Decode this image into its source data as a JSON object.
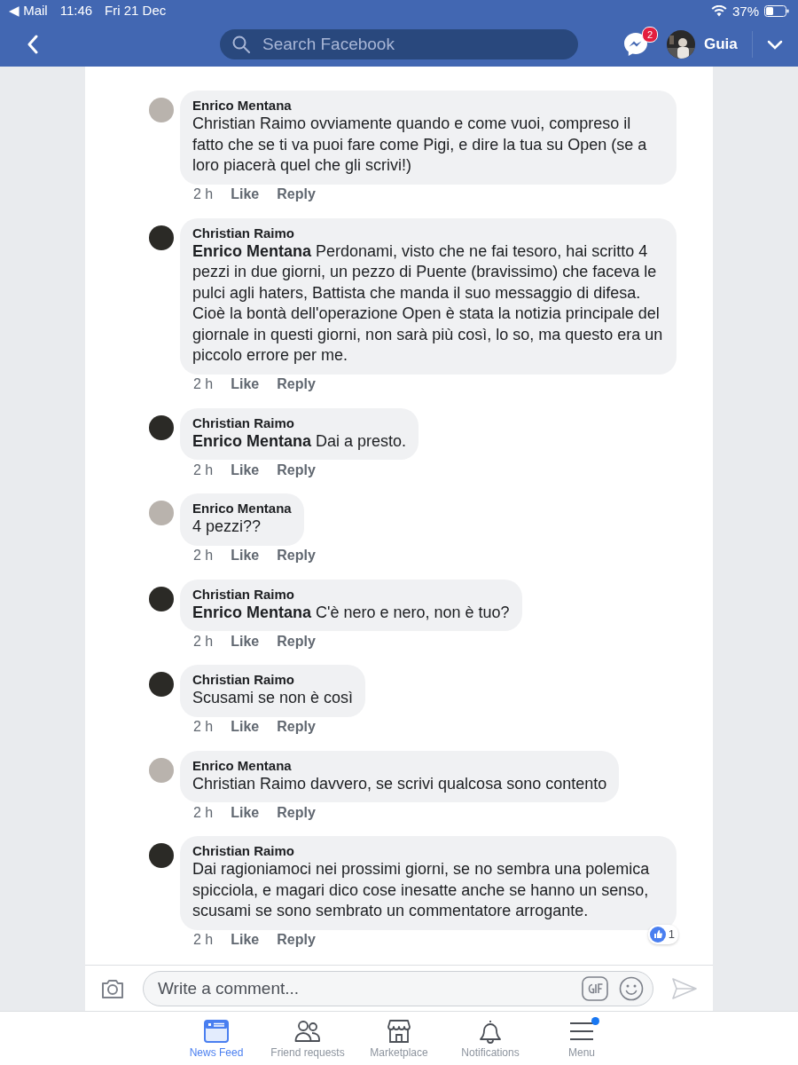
{
  "status_bar": {
    "back_app": "◀ Mail",
    "time": "11:46",
    "date": "Fri 21 Dec",
    "battery": "37%"
  },
  "header": {
    "search": {
      "placeholder": "Search Facebook"
    },
    "messenger_badge": "2",
    "user_name": "Guia"
  },
  "comments": [
    {
      "author": "Enrico Mentana",
      "color": "#b9b3ad",
      "text": "Christian Raimo ovviamente quando e come vuoi, compreso il fatto che se ti va puoi fare come Pigi, e dire la tua su Open (se a loro piacerà quel che gli scrivi!)",
      "time": "2 h",
      "like": "Like",
      "reply": "Reply"
    },
    {
      "author": "Christian Raimo",
      "color": "#2b2a26",
      "text": "**Enrico Mentana** Perdonami, visto che ne fai tesoro, hai scritto 4 pezzi in due giorni, un pezzo di Puente (bravissimo) che faceva le pulci agli haters, Battista che manda il suo messaggio di difesa. Cioè la bontà dell'operazione Open è stata la notizia principale del giornale in questi giorni, non sarà più così, lo so, ma questo era un piccolo errore per me.",
      "time": "2 h",
      "like": "Like",
      "reply": "Reply"
    },
    {
      "author": "Christian Raimo",
      "color": "#2b2a26",
      "text": "**Enrico Mentana** Dai a presto.",
      "time": "2 h",
      "like": "Like",
      "reply": "Reply"
    },
    {
      "author": "Enrico Mentana",
      "color": "#b9b3ad",
      "text": "4 pezzi??",
      "time": "2 h",
      "like": "Like",
      "reply": "Reply"
    },
    {
      "author": "Christian Raimo",
      "color": "#2b2a26",
      "text": "**Enrico Mentana** C'è nero e nero, non è tuo?",
      "time": "2 h",
      "like": "Like",
      "reply": "Reply"
    },
    {
      "author": "Christian Raimo",
      "color": "#2b2a26",
      "text": "Scusami se non è così",
      "time": "2 h",
      "like": "Like",
      "reply": "Reply"
    },
    {
      "author": "Enrico Mentana",
      "color": "#b9b3ad",
      "text": "Christian Raimo davvero, se scrivi qualcosa sono contento",
      "time": "2 h",
      "like": "Like",
      "reply": "Reply"
    },
    {
      "author": "Christian Raimo",
      "color": "#2b2a26",
      "text": "Dai ragioniamoci nei prossimi giorni, se no sembra una polemica spicciola, e magari dico cose inesatte anche se hanno un senso, scusami se sono sembrato un commentatore arrogante.",
      "time": "2 h",
      "like": "Like",
      "reply": "Reply",
      "reactions": "1"
    }
  ],
  "composer": {
    "placeholder": "Write a comment..."
  },
  "nav": [
    {
      "kind": "feed",
      "label": "News Feed",
      "selected": true,
      "dot": false
    },
    {
      "kind": "friends",
      "label": "Friend requests",
      "selected": false,
      "dot": false
    },
    {
      "kind": "market",
      "label": "Marketplace",
      "selected": false,
      "dot": false
    },
    {
      "kind": "bell",
      "label": "Notifications",
      "selected": false,
      "dot": false
    },
    {
      "kind": "menu",
      "label": "Menu",
      "selected": false,
      "dot": true
    }
  ]
}
